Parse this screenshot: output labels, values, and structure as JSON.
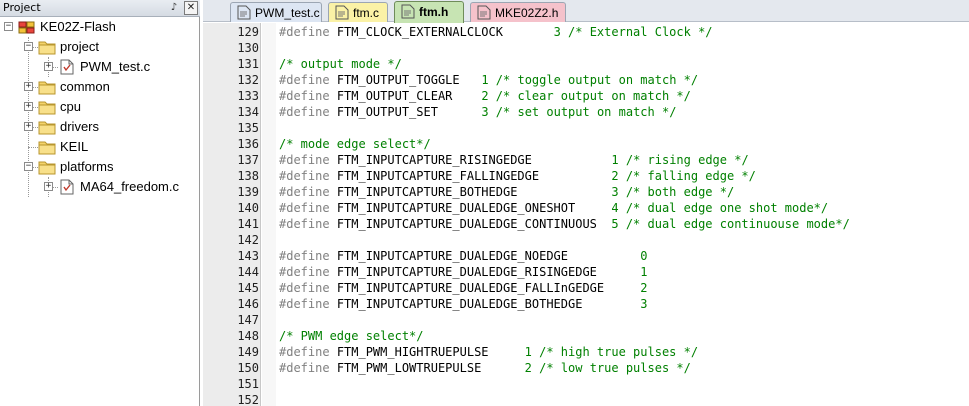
{
  "project_panel": {
    "title": "Project",
    "tree": [
      {
        "label": "KE02Z-Flash",
        "kind": "target",
        "expander": "−"
      },
      {
        "label": "project",
        "kind": "folder",
        "expander": "−"
      },
      {
        "label": "PWM_test.c",
        "kind": "file",
        "expander": "+"
      },
      {
        "label": "common",
        "kind": "folder",
        "expander": "+"
      },
      {
        "label": "cpu",
        "kind": "folder",
        "expander": "+"
      },
      {
        "label": "drivers",
        "kind": "folder",
        "expander": "+"
      },
      {
        "label": "KEIL",
        "kind": "folder",
        "expander": ""
      },
      {
        "label": "platforms",
        "kind": "folder",
        "expander": "−"
      },
      {
        "label": "MA64_freedom.c",
        "kind": "file",
        "expander": "+"
      }
    ]
  },
  "tabs": [
    {
      "label": "PWM_test.c",
      "active": false,
      "color": "#dde6f3"
    },
    {
      "label": "ftm.c",
      "active": false,
      "color": "#fbf2a6"
    },
    {
      "label": "ftm.h",
      "active": true,
      "color": "#c7e4b3"
    },
    {
      "label": "MKE02Z2.h",
      "active": false,
      "color": "#f5c2cb"
    }
  ],
  "code_lines": [
    {
      "n": "129",
      "kw": "#define",
      "name": "FTM_CLOCK_EXTERNALCLOCK",
      "val": "3",
      "comment": "/* External Clock */",
      "gap1": "       ",
      "gap2": " "
    },
    {
      "n": "130"
    },
    {
      "n": "131",
      "comment": "/* output mode */"
    },
    {
      "n": "132",
      "kw": "#define",
      "name": "FTM_OUTPUT_TOGGLE",
      "val": "1",
      "comment": "/* toggle output on match */",
      "gap1": "   ",
      "gap2": " "
    },
    {
      "n": "133",
      "kw": "#define",
      "name": "FTM_OUTPUT_CLEAR",
      "val": "2",
      "comment": "/* clear output on match */",
      "gap1": "    ",
      "gap2": " "
    },
    {
      "n": "134",
      "kw": "#define",
      "name": "FTM_OUTPUT_SET",
      "val": "3",
      "comment": "/* set output on match */",
      "gap1": "      ",
      "gap2": " "
    },
    {
      "n": "135"
    },
    {
      "n": "136",
      "comment": "/* mode edge select*/"
    },
    {
      "n": "137",
      "kw": "#define",
      "name": "FTM_INPUTCAPTURE_RISINGEDGE",
      "val": "1",
      "comment": "/* rising edge */",
      "gap1": "           ",
      "gap2": " "
    },
    {
      "n": "138",
      "kw": "#define",
      "name": "FTM_INPUTCAPTURE_FALLINGEDGE",
      "val": "2",
      "comment": "/* falling edge */",
      "gap1": "          ",
      "gap2": " "
    },
    {
      "n": "139",
      "kw": "#define",
      "name": "FTM_INPUTCAPTURE_BOTHEDGE",
      "val": "3",
      "comment": "/* both edge */",
      "gap1": "             ",
      "gap2": " "
    },
    {
      "n": "140",
      "kw": "#define",
      "name": "FTM_INPUTCAPTURE_DUALEDGE_ONESHOT",
      "val": "4",
      "comment": "/* dual edge one shot mode*/",
      "gap1": "     ",
      "gap2": " "
    },
    {
      "n": "141",
      "kw": "#define",
      "name": "FTM_INPUTCAPTURE_DUALEDGE_CONTINUOUS",
      "val": "5",
      "comment": "/* dual edge continuouse mode*/",
      "gap1": "  ",
      "gap2": " "
    },
    {
      "n": "142"
    },
    {
      "n": "143",
      "kw": "#define",
      "name": "FTM_INPUTCAPTURE_DUALEDGE_NOEDGE",
      "val": "0",
      "comment": "",
      "gap1": "          ",
      "gap2": ""
    },
    {
      "n": "144",
      "kw": "#define",
      "name": "FTM_INPUTCAPTURE_DUALEDGE_RISINGEDGE",
      "val": "1",
      "comment": "",
      "gap1": "      ",
      "gap2": ""
    },
    {
      "n": "145",
      "kw": "#define",
      "name": "FTM_INPUTCAPTURE_DUALEDGE_FALLInGEDGE",
      "val": "2",
      "comment": "",
      "gap1": "     ",
      "gap2": ""
    },
    {
      "n": "146",
      "kw": "#define",
      "name": "FTM_INPUTCAPTURE_DUALEDGE_BOTHEDGE",
      "val": "3",
      "comment": "",
      "gap1": "        ",
      "gap2": ""
    },
    {
      "n": "147"
    },
    {
      "n": "148",
      "comment": "/* PWM edge select*/"
    },
    {
      "n": "149",
      "kw": "#define",
      "name": "FTM_PWM_HIGHTRUEPULSE",
      "val": "1",
      "comment": "/* high true pulses */",
      "gap1": "     ",
      "gap2": " "
    },
    {
      "n": "150",
      "kw": "#define",
      "name": "FTM_PWM_LOWTRUEPULSE",
      "val": "2",
      "comment": "/* low true pulses */",
      "gap1": "      ",
      "gap2": " "
    },
    {
      "n": "151"
    },
    {
      "n": "152"
    }
  ],
  "colors": {
    "keyword": "#808080",
    "number": "#008000",
    "comment": "#008000",
    "gutter_bg": "#ececec"
  }
}
